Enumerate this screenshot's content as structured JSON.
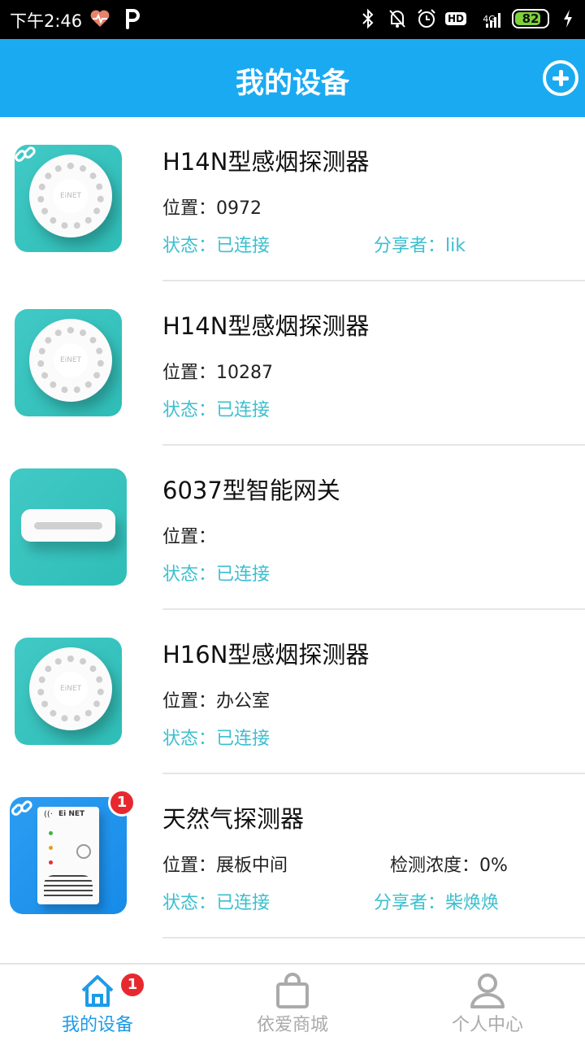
{
  "status_bar": {
    "time": "下午2:46",
    "network": "4G",
    "hd": "HD",
    "battery": "82",
    "battery_level": 0.82
  },
  "header": {
    "title": "我的设备",
    "add_icon": "plus-circle-icon"
  },
  "devices": [
    {
      "name": "H14N型感烟探测器",
      "location_label": "位置：",
      "location": "0972",
      "status_label": "状态：",
      "status": "已连接",
      "sharer_label": "分享者：",
      "sharer": "lik",
      "image": "smoke-detector",
      "linked": true
    },
    {
      "name": "H14N型感烟探测器",
      "location_label": "位置：",
      "location": "10287",
      "status_label": "状态：",
      "status": "已连接",
      "image": "smoke-detector",
      "linked": false
    },
    {
      "name": "6037型智能网关",
      "location_label": "位置：",
      "location": "",
      "status_label": "状态：",
      "status": "已连接",
      "image": "gateway",
      "linked": false
    },
    {
      "name": "H16N型感烟探测器",
      "location_label": "位置：",
      "location": "办公室",
      "status_label": "状态：",
      "status": "已连接",
      "image": "smoke-detector",
      "linked": false
    },
    {
      "name": "天然气探测器",
      "location_label": "位置：",
      "location": "展板中间",
      "concentration_label": "检测浓度：",
      "concentration": "0%",
      "status_label": "状态：",
      "status": "已连接",
      "sharer_label": "分享者：",
      "sharer": "柴焕焕",
      "image": "gas-detector",
      "linked": true,
      "badge": "1"
    }
  ],
  "gas_logo": "Ei NET",
  "bottom_nav": {
    "tabs": [
      {
        "label": "我的设备",
        "icon": "home-icon",
        "active": true,
        "badge": "1"
      },
      {
        "label": "依爱商城",
        "icon": "shopping-bag-icon",
        "active": false
      },
      {
        "label": "个人中心",
        "icon": "person-icon",
        "active": false
      }
    ]
  },
  "colors": {
    "header": "#1aaaf2",
    "status_text": "#3cbfcf",
    "active_tab": "#1e9be6",
    "inactive_tab": "#aaaaaa",
    "badge": "#e8282f"
  }
}
